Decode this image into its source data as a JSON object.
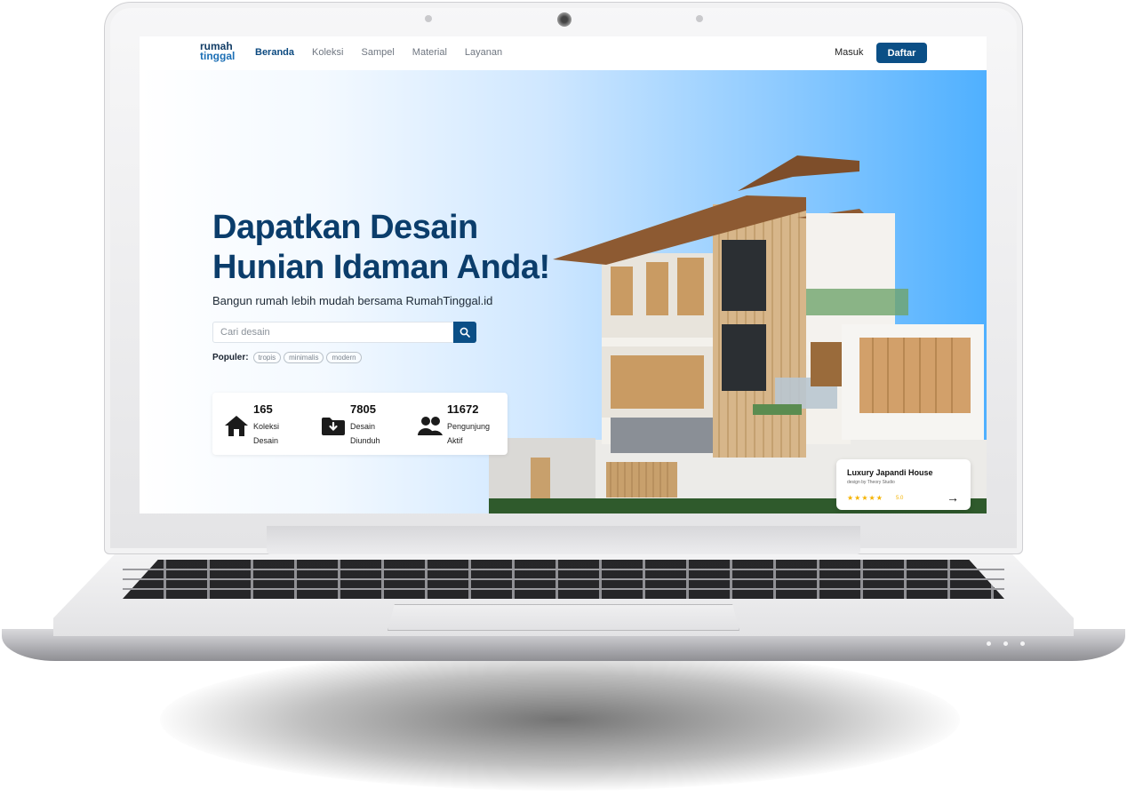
{
  "brand": {
    "logo_line1": "rumah",
    "logo_line2": "tinggal"
  },
  "nav": {
    "links": [
      {
        "label": "Beranda",
        "active": true
      },
      {
        "label": "Koleksi"
      },
      {
        "label": "Sampel"
      },
      {
        "label": "Material"
      },
      {
        "label": "Layanan"
      }
    ],
    "login_label": "Masuk",
    "register_label": "Daftar"
  },
  "hero": {
    "headline_line1": "Dapatkan Desain",
    "headline_line2": "Hunian Idaman Anda!",
    "subtitle": "Bangun rumah lebih mudah bersama RumahTinggal.id",
    "search_placeholder": "Cari desain",
    "popular_label": "Populer:",
    "popular_tags": [
      "tropis",
      "minimalis",
      "modern"
    ]
  },
  "stats": [
    {
      "icon": "house-icon",
      "value": "165",
      "label_line1": "Koleksi",
      "label_line2": "Desain"
    },
    {
      "icon": "folder-download-icon",
      "value": "7805",
      "label_line1": "Desain",
      "label_line2": "Diunduh"
    },
    {
      "icon": "users-icon",
      "value": "11672",
      "label_line1": "Pengunjung",
      "label_line2": "Aktif"
    }
  ],
  "featured": {
    "title": "Luxury Japandi House",
    "byline": "design by Theory Studio",
    "stars": "★★★★★",
    "rating": "5.0",
    "arrow": "→"
  },
  "colors": {
    "primary": "#0b4f86",
    "headline": "#0b3d6b",
    "star": "#f5b301"
  }
}
